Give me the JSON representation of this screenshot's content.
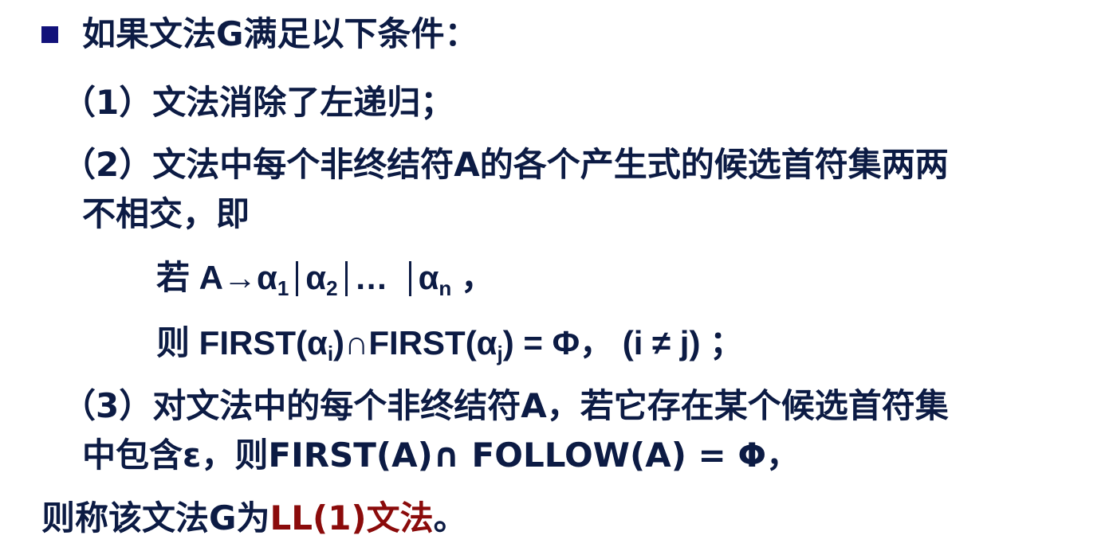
{
  "lines": {
    "l1": "如果文法G满足以下条件：",
    "l2": "（1）文法消除了左递归；",
    "l3": "（2）文法中每个非终结符A的各个产生式的候选首符集两两",
    "l4": "不相交，即",
    "l5": {
      "ruo": "若 A→α",
      "s1": "1",
      "a2": "α",
      "s2": "2",
      "dots": "…",
      "an": "α",
      "sn": "n",
      "tail": " ，"
    },
    "l6": {
      "a": "则 FIRST(α",
      "si": "i",
      "b": ")∩FIRST(α",
      "sj": "j",
      "c": ") = Φ，  (i ≠ j) ；"
    },
    "l7": "（3）对文法中的每个非终结符A，若它存在某个候选首符集",
    "l8": "中包含ε，则FIRST(A)∩ FOLLOW(A) = Φ，",
    "l9": {
      "pre": "则称该文法G为",
      "red": "LL(1)文法",
      "post": "。"
    }
  },
  "colors": {
    "text": "#0c1b44",
    "bullet": "#12127a",
    "highlight": "#8b0b0b"
  },
  "icons": {
    "bullet": "square-bullet-icon"
  }
}
